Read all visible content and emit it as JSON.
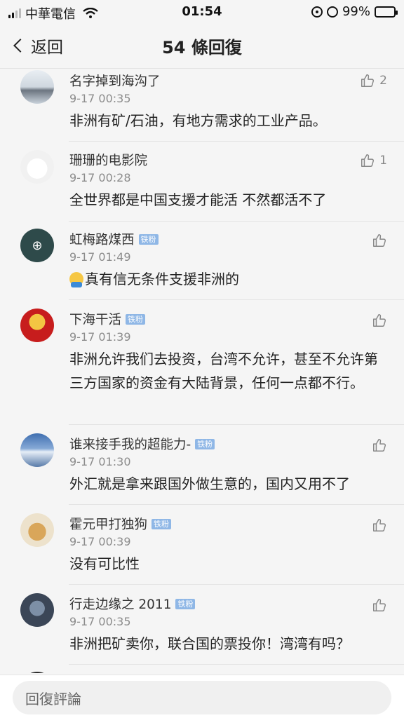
{
  "status_bar": {
    "carrier": "中華電信",
    "time": "01:54",
    "battery": "99%"
  },
  "nav": {
    "back_label": "返回",
    "title": "54 條回復"
  },
  "comments": [
    {
      "username": "名字掉到海沟了",
      "badge": "",
      "timestamp": "9-17 00:35",
      "content": "非洲有矿/石油，有地方需求的工业产品。",
      "likes": "2"
    },
    {
      "username": "珊珊的电影院",
      "badge": "",
      "timestamp": "9-17 00:28",
      "content": "全世界都是中国支援才能活 不然都活不了",
      "likes": "1"
    },
    {
      "username": "虹梅路煤西",
      "badge": "铁粉",
      "timestamp": "9-17 01:49",
      "content": "真有信无条件支援非洲的",
      "likes": ""
    },
    {
      "username": "下海干活",
      "badge": "铁粉",
      "timestamp": "9-17 01:39",
      "content": "非洲允许我们去投资，台湾不允许，甚至不允许第三方国家的资金有大陆背景，任何一点都不行。",
      "likes": ""
    },
    {
      "username": "谁来接手我的超能力-",
      "badge": "铁粉",
      "timestamp": "9-17 01:30",
      "content": "外汇就是拿来跟国外做生意的，国内又用不了",
      "likes": ""
    },
    {
      "username": "霍元甲打独狗",
      "badge": "铁粉",
      "timestamp": "9-17 00:39",
      "content": "没有可比性",
      "likes": ""
    },
    {
      "username": "行走边缘之 2011",
      "badge": "铁粉",
      "timestamp": "9-17 00:35",
      "content": "非洲把矿卖你，联合国的票投你！湾湾有吗？",
      "likes": ""
    }
  ],
  "reply": {
    "placeholder": "回復評論"
  }
}
